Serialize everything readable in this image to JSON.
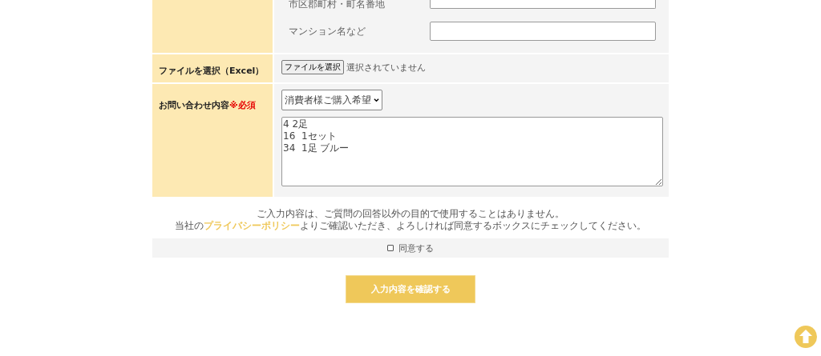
{
  "form": {
    "rows": [
      {
        "kind": "address",
        "label": "",
        "fields": [
          {
            "label": "市区郡町村・町名番地"
          },
          {
            "label": "マンション名など"
          }
        ]
      },
      {
        "kind": "file",
        "label": "ファイルを選択（Excel）",
        "button": "ファイルを選択",
        "status": "選択されていません"
      },
      {
        "kind": "inquiry",
        "label": "お問い合わせ内容",
        "required": "※必須",
        "select": "消費者様ご購入希望",
        "message": "4\t2足\n16\t1セット\n34\t1足 ブルー"
      }
    ]
  },
  "notice": {
    "line1": "ご入力内容は、ご質問の回答以外の目的で使用することはありません。",
    "prefix": "当社の",
    "link": "プライバシーポリシー",
    "suffix": "よりご確認いただき、よろしければ同意するボックスにチェックしてください。"
  },
  "agree": {
    "label": "同意する",
    "checked": false
  },
  "submit": "入力内容を確認する"
}
